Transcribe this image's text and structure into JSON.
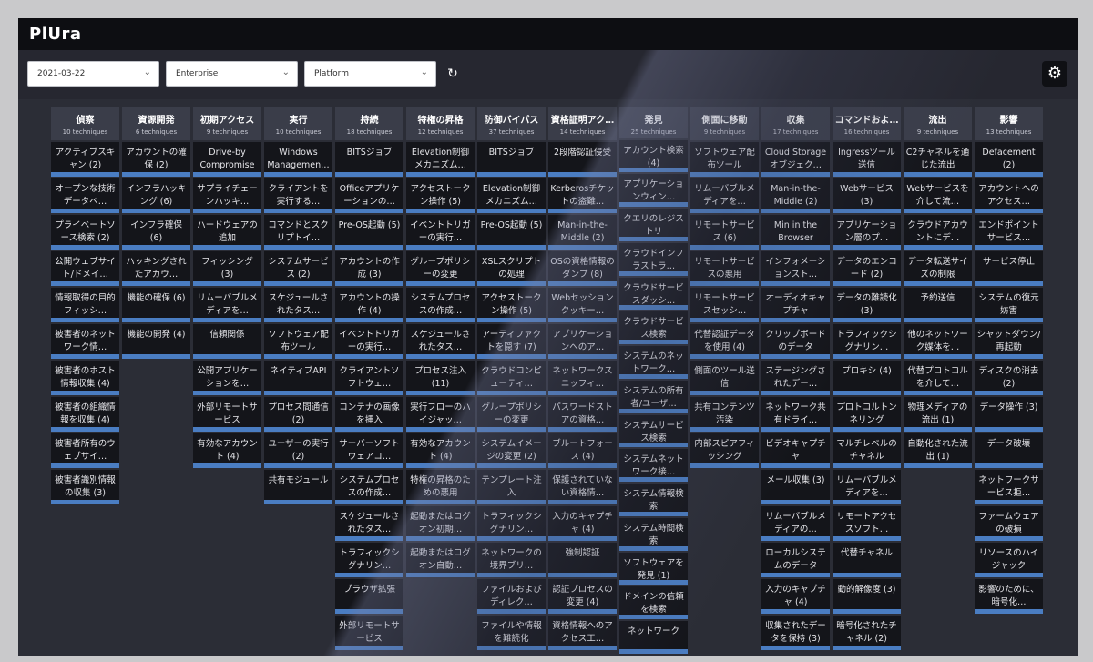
{
  "app": {
    "logo": "PlUra"
  },
  "filters": {
    "date": "2021-03-22",
    "domain": "Enterprise",
    "platform": "Platform"
  },
  "icons": {
    "refresh": "refresh-icon",
    "settings": "gear-icon",
    "chevron": "chevron-down-icon"
  },
  "colors": {
    "accent": "#4a7dc2",
    "header": "#3a3d49",
    "cell": "#14151a"
  },
  "columns": [
    {
      "title": "偵察",
      "count": "10 techniques",
      "items": [
        "アクティブスキャン (2)",
        "オープンな技術データベ…",
        "プライベートソース検索 (2)",
        "公開ウェブサイト/ドメイ…",
        "情報取得の目的フィッシ…",
        "被害者のネットワーク情…",
        "被害者のホスト情報収集 (4)",
        "被害者の組織情報を収集 (4)",
        "被害者所有のウェブサイ…",
        "被害者識別情報の収集 (3)"
      ]
    },
    {
      "title": "資源開発",
      "count": "6 techniques",
      "items": [
        "アカウントの確保 (2)",
        "インフラハッキング (6)",
        "インフラ確保 (6)",
        "ハッキングされたアカウ…",
        "機能の確保 (6)",
        "機能の開発 (4)"
      ]
    },
    {
      "title": "初期アクセス",
      "count": "9 techniques",
      "items": [
        "Drive-by Compromise",
        "サプライチェーンハッキ…",
        "ハードウェアの追加",
        "フィッシング (3)",
        "リムーバブルメディアを…",
        "信頼関係",
        "公開アプリケーションを…",
        "外部リモートサービス",
        "有効なアカウント (4)"
      ]
    },
    {
      "title": "実行",
      "count": "10 techniques",
      "items": [
        "Windows Managemen…",
        "クライアントを実行する…",
        "コマンドとスクリプトイ…",
        "システムサービス (2)",
        "スケジュールされたタス…",
        "ソフトウェア配布ツール",
        "ネイティブAPI",
        "プロセス間通信 (2)",
        "ユーザーの実行 (2)",
        "共有モジュール"
      ]
    },
    {
      "title": "持続",
      "count": "18 techniques",
      "items": [
        "BITSジョブ",
        "Officeアプリケーションの…",
        "Pre-OS起動 (5)",
        "アカウントの作成 (3)",
        "アカウントの操作 (4)",
        "イベントトリガーの実行…",
        "クライアントソフトウェ…",
        "コンテナの画像を挿入",
        "サーバーソフトウェアコ…",
        "システムプロセスの作成…",
        "スケジュールされたタス…",
        "トラフィックシグナリン…",
        "ブラウザ拡張",
        "外部リモートサービス"
      ]
    },
    {
      "title": "特権の昇格",
      "count": "12 techniques",
      "items": [
        "Elevation制御メカニズム…",
        "アクセストークン操作 (5)",
        "イベントトリガーの実行…",
        "グループポリシーの変更",
        "システムプロセスの作成…",
        "スケジュールされたタス…",
        "プロセス注入 (11)",
        "実行フローのハイジャッ…",
        "有効なアカウント (4)",
        "特権の昇格のための悪用",
        "起動またはログオン初期…",
        "起動またはログオン自動…"
      ]
    },
    {
      "title": "防御バイパス",
      "count": "37 techniques",
      "items": [
        "BITSジョブ",
        "Elevation制御メカニズム…",
        "Pre-OS起動 (5)",
        "XSLスクリプトの処理",
        "アクセストークン操作 (5)",
        "アーティファクトを隠す (7)",
        "クラウドコンピューティ…",
        "グループポリシーの変更",
        "システムイメージの変更 (2)",
        "テンプレート注入",
        "トラフィックシグナリン…",
        "ネットワークの境界ブリ…",
        "ファイルおよびディレク…",
        "ファイルや情報を難読化"
      ]
    },
    {
      "title": "資格証明アク…",
      "count": "14 techniques",
      "items": [
        "2段階認証侵受",
        "Kerberosチケットの盗難…",
        "Man-in-the-Middle (2)",
        "OSの資格情報のダンプ (8)",
        "Webセッションクッキー…",
        "アプリケーションへのア…",
        "ネットワークスニッフィ…",
        "パスワードストアの資格…",
        "ブルートフォース (4)",
        "保護されていない資格情…",
        "入力のキャプチャ (4)",
        "強制認証",
        "認証プロセスの変更 (4)",
        "資格情報へのアクセス工…"
      ]
    },
    {
      "title": "発見",
      "count": "25 techniques",
      "items": [
        "アカウント検索 (4)",
        "アプリケーションウィン…",
        "クエリのレジストリ",
        "クラウドインフラストラ…",
        "クラウドサービスダッシ…",
        "クラウドサービス検索",
        "システムのネットワーク…",
        "システムの所有者/ユーザ…",
        "システムサービス検索",
        "システムネットワーク接…",
        "システム情報検索",
        "システム時間検索",
        "ソフトウェアを発見 (1)",
        "ドメインの信頼を検索",
        "ネットワーク"
      ]
    },
    {
      "title": "側面に移動",
      "count": "9 techniques",
      "items": [
        "ソフトウェア配布ツール",
        "リムーバブルメディアを…",
        "リモートサービス (6)",
        "リモートサービスの悪用",
        "リモートサービスセッシ…",
        "代替認証データを使用 (4)",
        "側面のツール送信",
        "共有コンテンツ汚染",
        "内部スピアフィッシング"
      ]
    },
    {
      "title": "収集",
      "count": "17 techniques",
      "items": [
        "Cloud Storageオブジェク…",
        "Man-in-the-Middle (2)",
        "Min in the Browser",
        "インフォメーションスト…",
        "オーディオキャプチャ",
        "クリップボードのデータ",
        "ステージングされたデー…",
        "ネットワーク共有ドライ…",
        "ビデオキャプチャ",
        "メール収集 (3)",
        "リムーバブルメディアの…",
        "ローカルシステムのデータ",
        "入力のキャプチャ (4)",
        "収集されたデータを保持 (3)"
      ]
    },
    {
      "title": "コマンドおよ…",
      "count": "16 techniques",
      "items": [
        "Ingressツール送信",
        "Webサービス (3)",
        "アプリケーション層のプ…",
        "データのエンコード (2)",
        "データの難読化 (3)",
        "トラフィックシグナリン…",
        "プロキシ (4)",
        "プロトコルトンネリング",
        "マルチレベルのチャネル",
        "リムーバブルメディアを…",
        "リモートアクセスソフト…",
        "代替チャネル",
        "動的解像度 (3)",
        "暗号化されたチャネル (2)"
      ]
    },
    {
      "title": "流出",
      "count": "9 techniques",
      "items": [
        "C2チャネルを通じた流出",
        "Webサービスを介して流…",
        "クラウドアカウントにデ…",
        "データ転送サイズの制限",
        "予約送信",
        "他のネットワーク媒体を…",
        "代替プロトコルを介して…",
        "物理メディアの流出 (1)",
        "自動化された流出 (1)"
      ]
    },
    {
      "title": "影響",
      "count": "13 techniques",
      "items": [
        "Defacement (2)",
        "アカウントへのアクセス…",
        "エンドポイントサービス…",
        "サービス停止",
        "システムの復元妨害",
        "シャットダウン/再起動",
        "ディスクの消去 (2)",
        "データ操作 (3)",
        "データ破壊",
        "ネットワークサービス拒…",
        "ファームウェアの破損",
        "リソースのハイジャック",
        "影響のために、暗号化…"
      ]
    }
  ]
}
